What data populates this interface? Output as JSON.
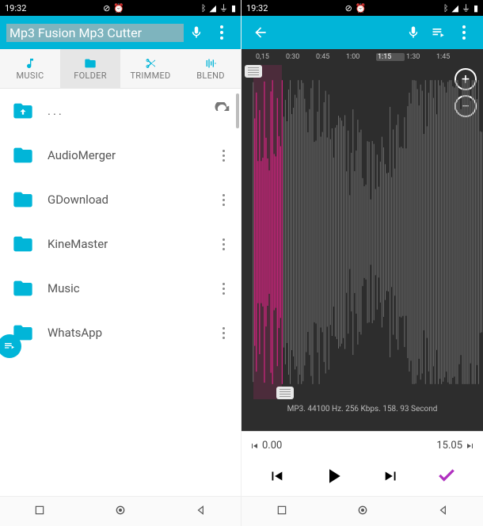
{
  "status": {
    "time_left": "19:32",
    "time_right": "19:32",
    "battery": "84"
  },
  "left": {
    "title": "Mp3 Fusion Mp3 Cutter",
    "tabs": {
      "music": "MUSIC",
      "folder": "FOLDER",
      "trimmed": "TRIMMED",
      "blend": "BLEND"
    },
    "parent_label": "...",
    "folders": [
      {
        "name": "AudioMerger"
      },
      {
        "name": "GDownload"
      },
      {
        "name": "KineMaster"
      },
      {
        "name": "Music"
      },
      {
        "name": "WhatsApp"
      }
    ]
  },
  "right": {
    "ruler": [
      "0,15",
      "0:30",
      "0:45",
      "1:00",
      "1:15",
      "1:30",
      "1:45"
    ],
    "ruler_selected_index": 4,
    "info": "MP3. 44100 Hz. 256 Kbps. 158. 93 Second",
    "start_time": "0.00",
    "end_time": "15.05",
    "zoom_in": "+",
    "zoom_out": "−"
  }
}
